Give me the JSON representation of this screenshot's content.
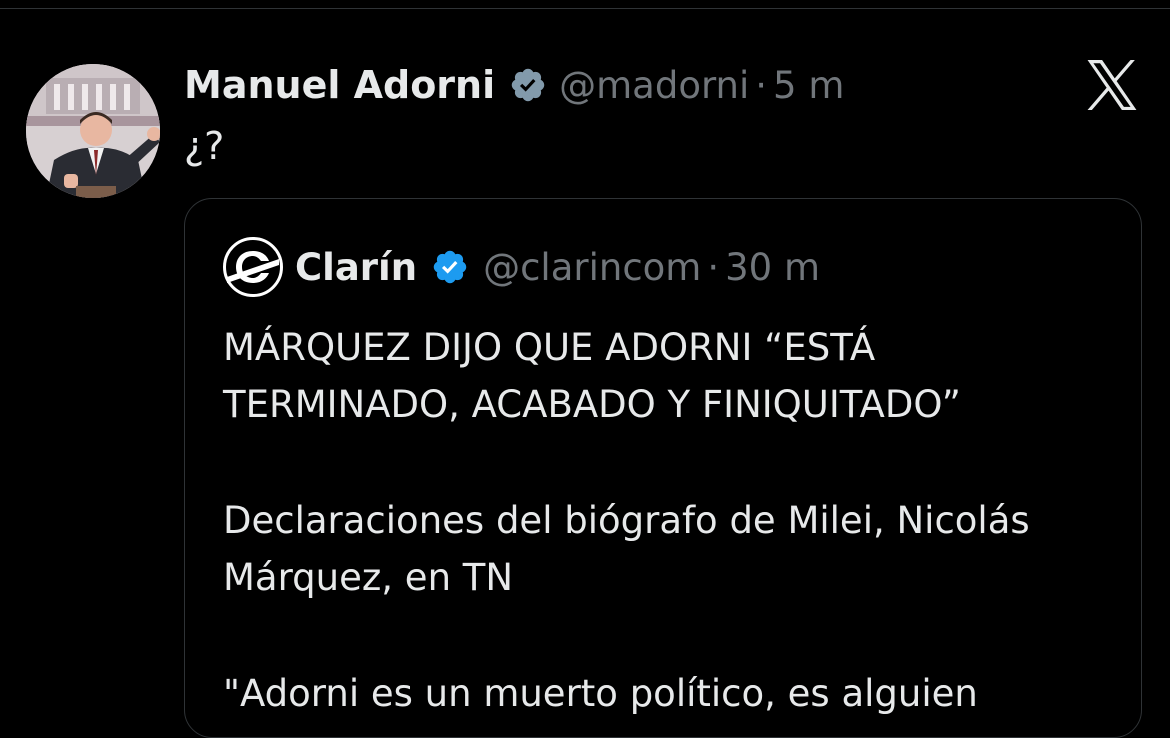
{
  "tweet": {
    "author_name": "Manuel Adorni",
    "author_handle": "@madorni",
    "separator": "·",
    "time": "5 m",
    "text": "¿?",
    "avatar_icon": "profile-photo",
    "verified_icon": "verified-badge-icon"
  },
  "brand": {
    "logo_icon": "x-logo-icon"
  },
  "quote": {
    "author_name": "Clarín",
    "author_handle": "@clarincom",
    "separator": "·",
    "time": "30 m",
    "headline_line1": "MÁRQUEZ DIJO QUE ADORNI “ESTÁ",
    "headline_line2": "TERMINADO, ACABADO Y FINIQUITADO”",
    "para2_line1": "Declaraciones del biógrafo de Milei, Nicolás",
    "para2_line2": "Márquez, en TN",
    "para3_line1": "\"Adorni es un muerto político, es alguien",
    "avatar_icon": "clarin-logo-icon"
  },
  "colors": {
    "background": "#000000",
    "primary_text": "#e7e9ea",
    "secondary_text": "#71767b",
    "verified_blue": "#1d9bf0",
    "verified_gray": "#829aab",
    "border": "#2f3336"
  }
}
